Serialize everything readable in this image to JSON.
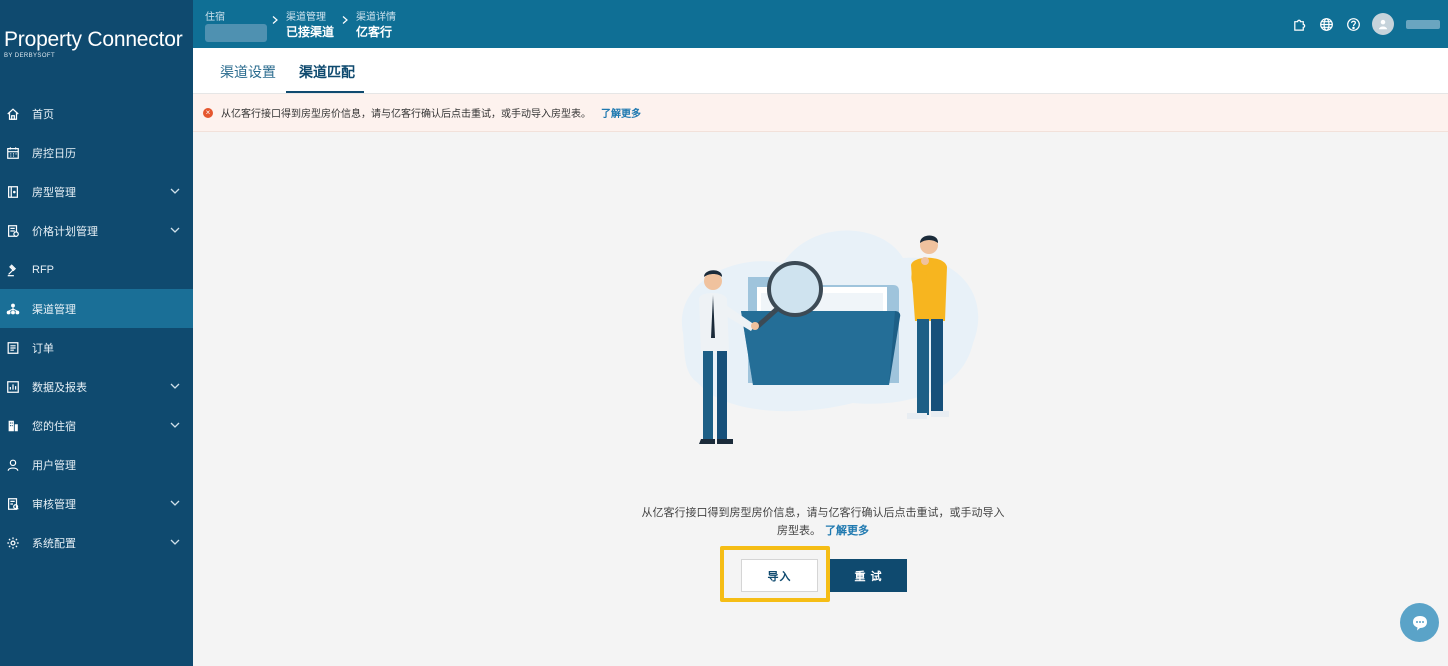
{
  "app": {
    "logo_main": "Property Connector",
    "logo_sub": "BY DERBYSOFT"
  },
  "sidebar": {
    "items": [
      {
        "label": "首页",
        "icon": "home-icon",
        "has_chevron": false
      },
      {
        "label": "房控日历",
        "icon": "calendar-icon",
        "has_chevron": false
      },
      {
        "label": "房型管理",
        "icon": "room-icon",
        "has_chevron": true
      },
      {
        "label": "价格计划管理",
        "icon": "price-plan-icon",
        "has_chevron": true
      },
      {
        "label": "RFP",
        "icon": "gavel-icon",
        "has_chevron": false
      },
      {
        "label": "渠道管理",
        "icon": "channel-icon",
        "has_chevron": false,
        "active": true
      },
      {
        "label": "订单",
        "icon": "order-icon",
        "has_chevron": false
      },
      {
        "label": "数据及报表",
        "icon": "report-icon",
        "has_chevron": true
      },
      {
        "label": "您的住宿",
        "icon": "building-icon",
        "has_chevron": true
      },
      {
        "label": "用户管理",
        "icon": "user-icon",
        "has_chevron": false
      },
      {
        "label": "审核管理",
        "icon": "audit-icon",
        "has_chevron": true
      },
      {
        "label": "系统配置",
        "icon": "settings-icon",
        "has_chevron": true
      }
    ]
  },
  "header": {
    "breadcrumb": [
      {
        "small": "住宿",
        "strong": ""
      },
      {
        "small": "渠道管理",
        "strong": "已接渠道"
      },
      {
        "small": "渠道详情",
        "strong": "亿客行"
      }
    ],
    "icons": [
      "puzzle-icon",
      "globe-icon",
      "help-icon"
    ]
  },
  "tabs": [
    {
      "label": "渠道设置",
      "active": false
    },
    {
      "label": "渠道匹配",
      "active": true
    }
  ],
  "alert": {
    "text": "从亿客行接口得到房型房价信息，请与亿客行确认后点击重试，或手动导入房型表。",
    "link": "了解更多"
  },
  "main": {
    "message_line1": "从亿客行接口得到房型房价信息，请与亿客行确认后点击重试，或手动导入",
    "message_line2": "房型表。",
    "message_link": "了解更多",
    "import_label": "导入",
    "retry_label": "重 试"
  },
  "colors": {
    "sidebar_bg": "#0f4a6f",
    "header_bg": "#0f6f95",
    "active_item": "#1a6f97",
    "highlight": "#f5bd15",
    "alert_icon": "#e5562e"
  }
}
